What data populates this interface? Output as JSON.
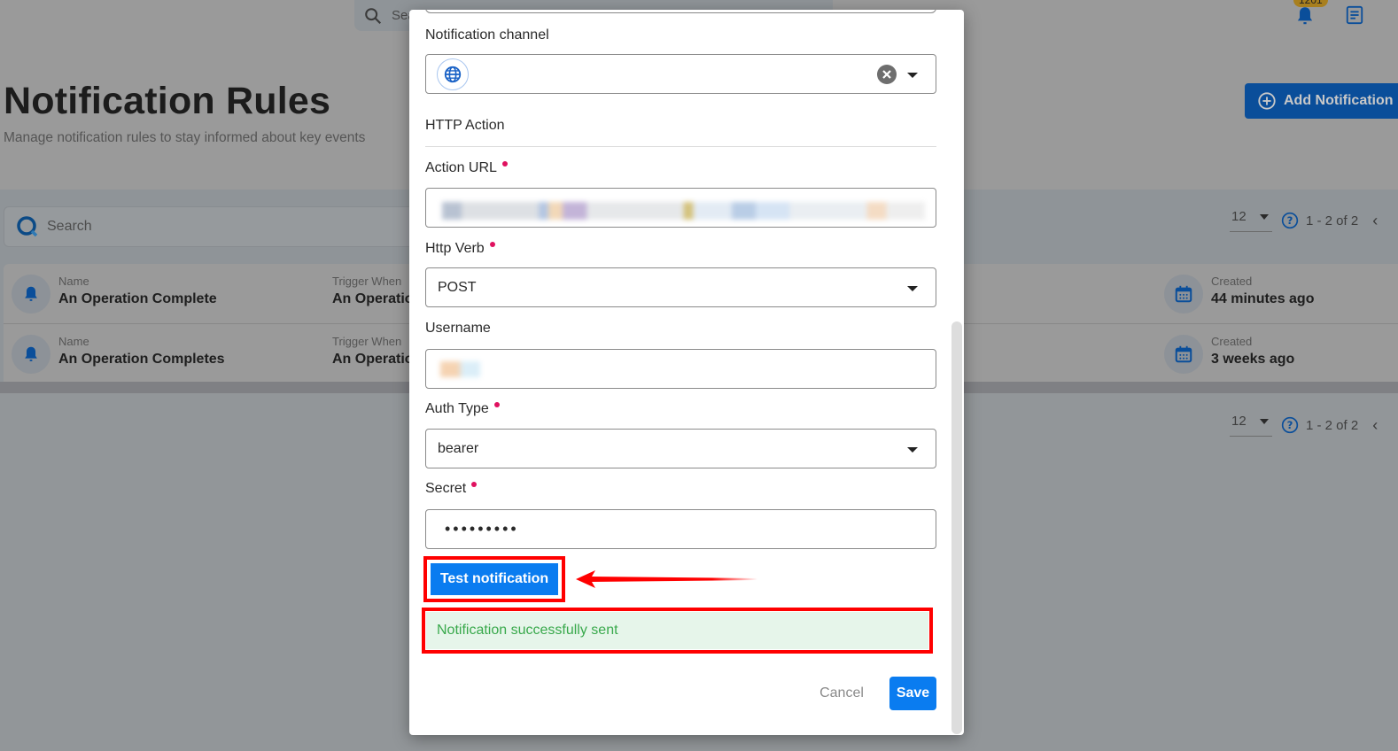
{
  "topbar": {
    "search_placeholder": "Sea",
    "notification_count": "1201"
  },
  "page": {
    "title": "Notification Rules",
    "subtitle": "Manage notification rules to stay informed about key events",
    "add_button_label": "Add Notification"
  },
  "list": {
    "search_placeholder": "Search",
    "page_size": "12",
    "range_text": "1 - 2 of 2",
    "rows": [
      {
        "name_label": "Name",
        "name": "An Operation Complete",
        "trigger_label": "Trigger When",
        "trigger": "An Operatio",
        "created_label": "Created",
        "created": "44 minutes ago"
      },
      {
        "name_label": "Name",
        "name": "An Operation Completes",
        "trigger_label": "Trigger When",
        "trigger": "An Operatio",
        "created_label": "Created",
        "created": "3 weeks ago"
      }
    ]
  },
  "modal": {
    "notification_channel_label": "Notification channel",
    "http_action_title": "HTTP Action",
    "action_url_label": "Action URL",
    "http_verb_label": "Http Verb",
    "http_verb_value": "POST",
    "username_label": "Username",
    "auth_type_label": "Auth Type",
    "auth_type_value": "bearer",
    "secret_label": "Secret",
    "secret_value": "•••••••••",
    "test_button_label": "Test notification",
    "success_message": "Notification successfully sent",
    "cancel_label": "Cancel",
    "save_label": "Save"
  },
  "colors": {
    "primary": "#0a7cf0",
    "required_dot": "#e0115f",
    "success_text": "#39a94c",
    "success_bg": "#e6f5ea",
    "annotation_red": "#ff0000"
  }
}
